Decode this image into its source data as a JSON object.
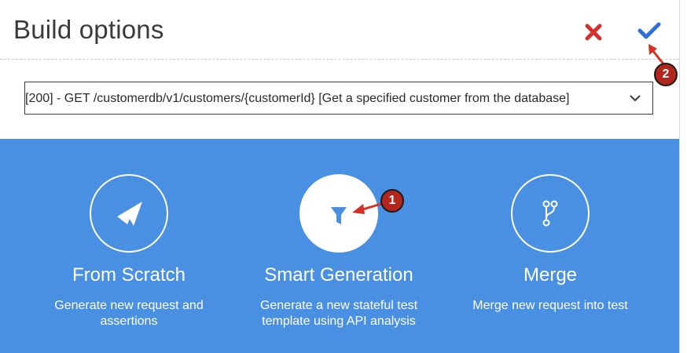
{
  "dialog": {
    "title": "Build options",
    "close_icon": "close-x-icon",
    "confirm_icon": "checkmark-icon"
  },
  "endpoint_select": {
    "value": "[200] - GET /customerdb/v1/customers/{customerId} [Get a specified customer from the database]",
    "icon": "chevron-down-icon"
  },
  "options": [
    {
      "icon": "paper-plane-icon",
      "title": "From Scratch",
      "desc_line1": "Generate new request and",
      "desc_line2": "assertions"
    },
    {
      "icon": "funnel-filter-icon",
      "title": "Smart Generation",
      "desc_line1": "Generate a new stateful test",
      "desc_line2": "template using API analysis"
    },
    {
      "icon": "git-branch-merge-icon",
      "title": "Merge",
      "desc_line1": "Merge new request into test",
      "desc_line2": ""
    }
  ],
  "callouts": [
    {
      "number": "1"
    },
    {
      "number": "2"
    }
  ],
  "colors": {
    "panel_blue": "#4a90e2",
    "close_red": "#d62f2f",
    "confirm_blue": "#2f6fe0",
    "callout_red": "#b3261e"
  }
}
